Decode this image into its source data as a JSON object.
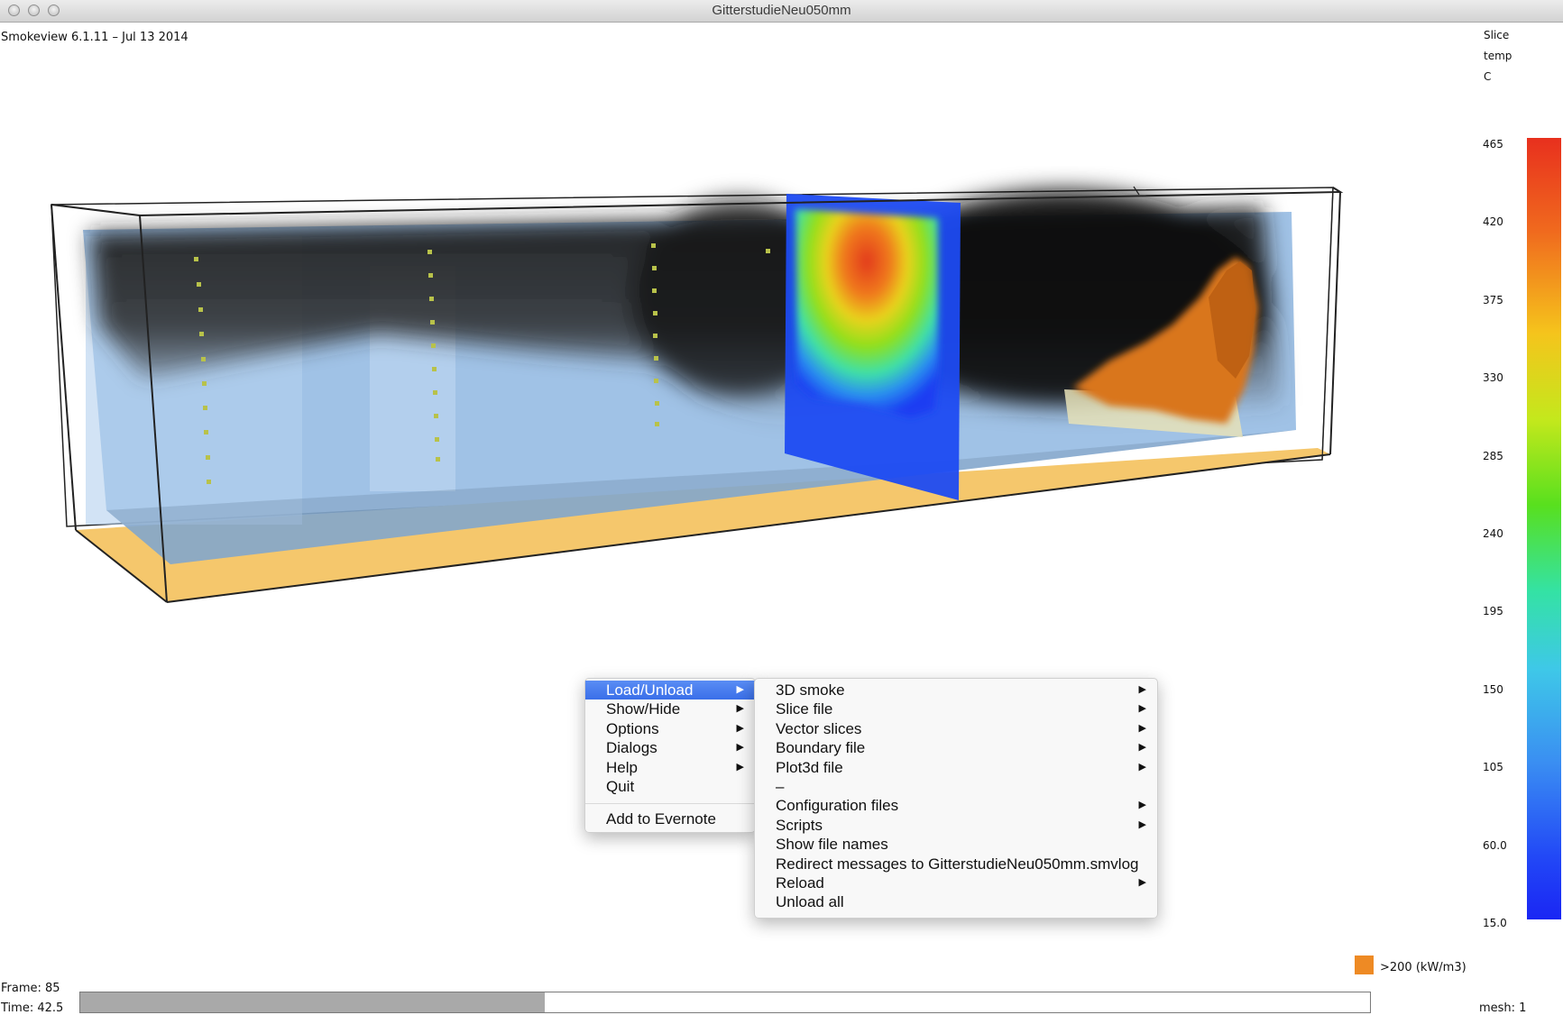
{
  "window": {
    "title": "GitterstudieNeu050mm"
  },
  "header": {
    "version": "Smokeview 6.1.11 – Jul 13 2014"
  },
  "colorbar": {
    "label_line1": "Slice",
    "label_line2": "temp",
    "unit": "C",
    "ticks": [
      "465",
      "420",
      "375",
      "330",
      "285",
      "240",
      "195",
      "150",
      "105",
      "60.0",
      "15.0"
    ]
  },
  "legend": {
    "hrr_label": ">200 (kW/m3)"
  },
  "status": {
    "frame": "Frame: 85",
    "time": "Time: 42.5",
    "mesh": "mesh: 1",
    "time_progress": 0.36
  },
  "main_menu": {
    "items": [
      {
        "label": "Load/Unload",
        "submenu": true
      },
      {
        "label": "Show/Hide",
        "submenu": true
      },
      {
        "label": "Options",
        "submenu": true
      },
      {
        "label": "Dialogs",
        "submenu": true
      },
      {
        "label": "Help",
        "submenu": true
      },
      {
        "label": "Quit",
        "submenu": false
      }
    ],
    "extra": "Add to Evernote"
  },
  "sub_menu": {
    "items": [
      {
        "label": "3D smoke",
        "submenu": true
      },
      {
        "label": "Slice file",
        "submenu": true
      },
      {
        "label": "Vector slices",
        "submenu": true
      },
      {
        "label": "Boundary file",
        "submenu": true
      },
      {
        "label": "Plot3d file",
        "submenu": true
      },
      {
        "label": "–",
        "submenu": false
      },
      {
        "label": "Configuration files",
        "submenu": true
      },
      {
        "label": "Scripts",
        "submenu": true
      },
      {
        "label": "Show file names",
        "submenu": false
      },
      {
        "label": "Redirect messages to GitterstudieNeu050mm.smvlog",
        "submenu": false
      },
      {
        "label": "Reload",
        "submenu": true
      },
      {
        "label": "Unload all",
        "submenu": false
      }
    ]
  },
  "colors": {
    "floor": "#f5c76c",
    "slice_hot": "#e23a1c",
    "fire": "#d9761e",
    "submenu_arrow": "▶"
  }
}
